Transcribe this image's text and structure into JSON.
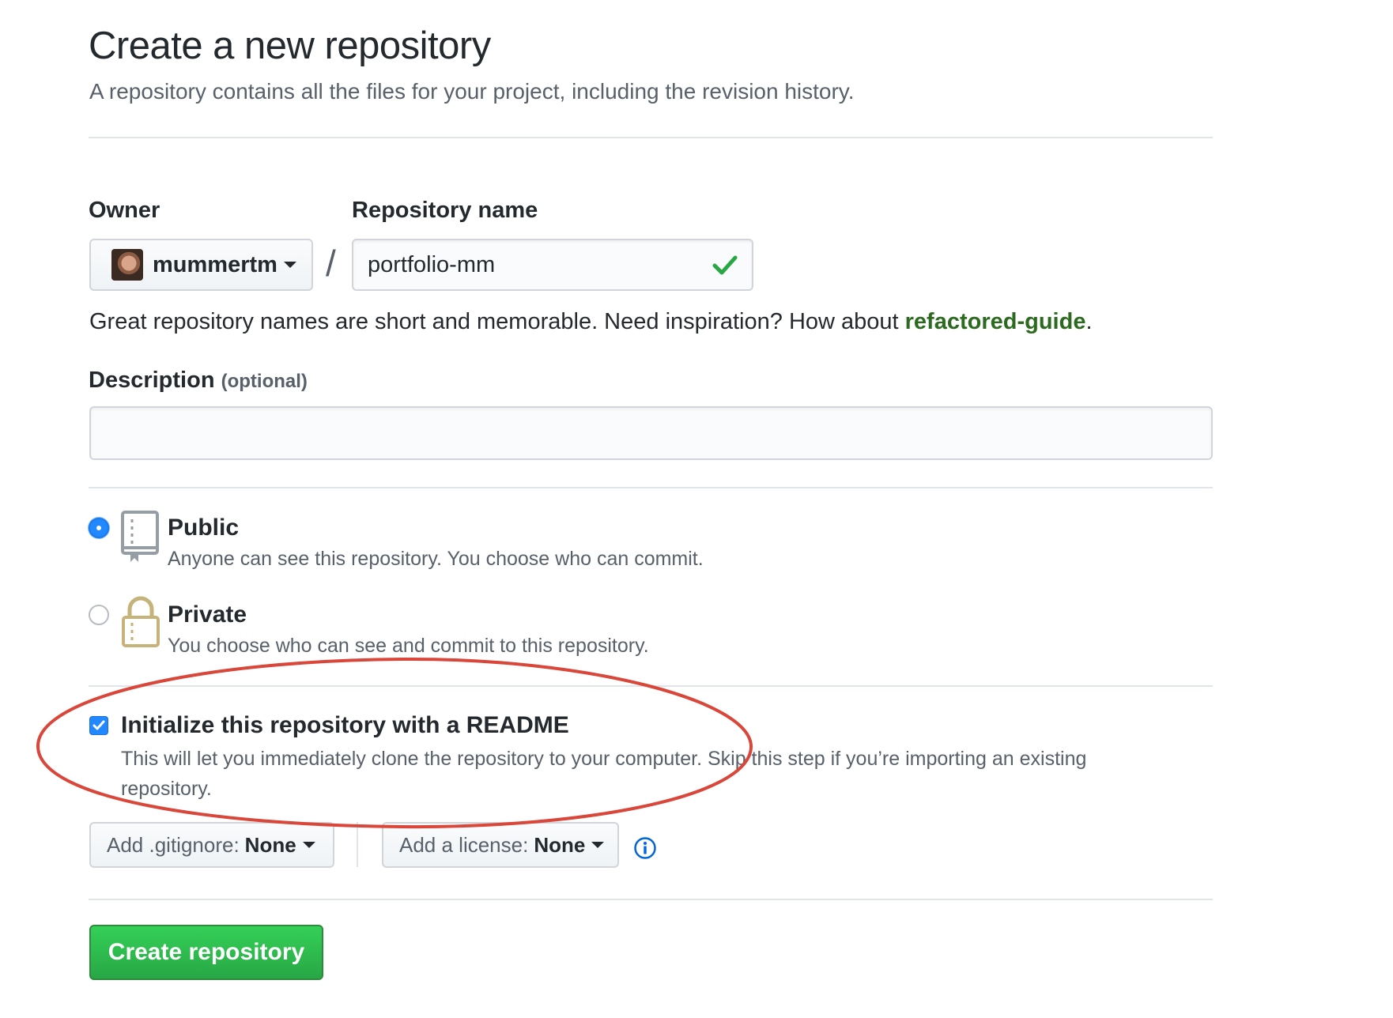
{
  "header": {
    "title": "Create a new repository",
    "subtitle": "A repository contains all the files for your project, including the revision history."
  },
  "owner": {
    "label": "Owner",
    "value": "mummertm"
  },
  "separator": "/",
  "repository_name": {
    "label": "Repository name",
    "value": "portfolio-mm",
    "valid": true
  },
  "name_hint": {
    "text": "Great repository names are short and memorable. Need inspiration? How about ",
    "suggestion": "refactored-guide",
    "suffix": "."
  },
  "description": {
    "label": "Description",
    "optional": "(optional)",
    "value": ""
  },
  "visibility": {
    "selected": "public",
    "public": {
      "title": "Public",
      "description": "Anyone can see this repository. You choose who can commit."
    },
    "private": {
      "title": "Private",
      "description": "You choose who can see and commit to this repository."
    }
  },
  "readme": {
    "checked": true,
    "title": "Initialize this repository with a README",
    "description": "This will let you immediately clone the repository to your computer. Skip this step if you’re importing an existing repository."
  },
  "gitignore": {
    "prefix": "Add .gitignore:",
    "value": "None"
  },
  "license": {
    "prefix": "Add a license:",
    "value": "None"
  },
  "create_button": "Create repository",
  "colors": {
    "accent_blue": "#2188ff",
    "success_green": "#28a745",
    "suggestion_green": "#2b6a1f",
    "annotation_red": "#d9463a"
  }
}
